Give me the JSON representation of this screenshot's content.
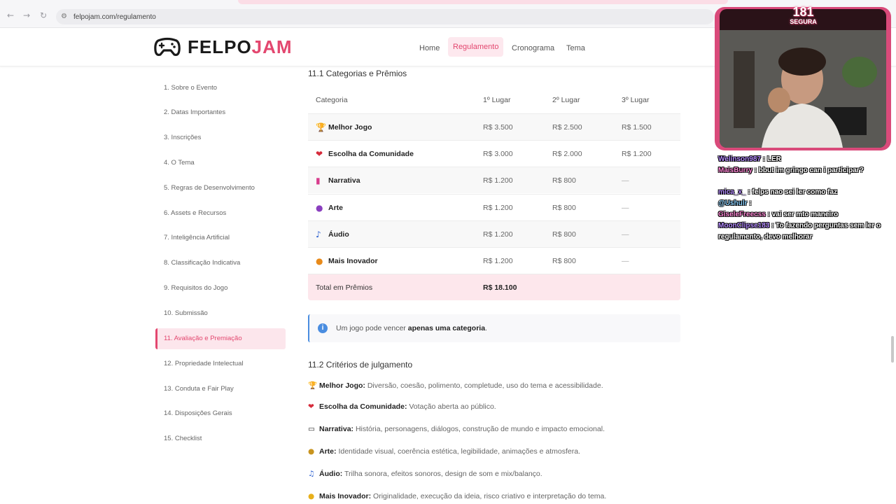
{
  "browser": {
    "url": "felpojam.com/regulamento",
    "back_icon": "back-arrow-icon",
    "forward_icon": "forward-arrow-icon",
    "reload_icon": "reload-icon"
  },
  "header": {
    "logo_part1": "FELPO",
    "logo_part2": "JAM",
    "nav": [
      "Home",
      "Regulamento",
      "Cronograma",
      "Tema"
    ],
    "active_nav": "Regulamento",
    "accent_color": "#e3476f"
  },
  "sidebar": {
    "items": [
      "1. Sobre o Evento",
      "2. Datas Importantes",
      "3. Inscrições",
      "4. O Tema",
      "5. Regras de Desenvolvimento",
      "6. Assets e Recursos",
      "7. Inteligência Artificial",
      "8. Classificação Indicativa",
      "9. Requisitos do Jogo",
      "10. Submissão",
      "11. Avaliação e Premiação",
      "12. Propriedade Intelectual",
      "13. Conduta e Fair Play",
      "14. Disposições Gerais",
      "15. Checklist"
    ],
    "active_index": 10
  },
  "main": {
    "section1_title": "11.1 Categorias e Prêmios",
    "table": {
      "headers": [
        "Categoria",
        "1º Lugar",
        "2º Lugar",
        "3º Lugar"
      ],
      "rows": [
        {
          "icon": "trophy-icon",
          "name": "Melhor Jogo",
          "p1": "R$ 3.500",
          "p2": "R$ 2.500",
          "p3": "R$ 1.500"
        },
        {
          "icon": "heart-icon",
          "name": "Escolha da Comunidade",
          "p1": "R$ 3.000",
          "p2": "R$ 2.000",
          "p3": "R$ 1.200"
        },
        {
          "icon": "book-icon",
          "name": "Narrativa",
          "p1": "R$ 1.200",
          "p2": "R$ 800",
          "p3": "—"
        },
        {
          "icon": "palette-icon",
          "name": "Arte",
          "p1": "R$ 1.200",
          "p2": "R$ 800",
          "p3": "—"
        },
        {
          "icon": "music-note-icon",
          "name": "Áudio",
          "p1": "R$ 1.200",
          "p2": "R$ 800",
          "p3": "—"
        },
        {
          "icon": "lightbulb-icon",
          "name": "Mais Inovador",
          "p1": "R$ 1.200",
          "p2": "R$ 800",
          "p3": "—"
        }
      ],
      "total_label": "Total em Prêmios",
      "total_value": "R$ 18.100"
    },
    "info": {
      "text_before": "Um jogo pode vencer ",
      "text_bold": "apenas uma categoria",
      "text_after": "."
    },
    "section2_title": "11.2 Critérios de julgamento",
    "criteria": [
      {
        "icon": "trophy-icon",
        "label": "Melhor Jogo:",
        "text": "Diversão, coesão, polimento, completude, uso do tema e acessibilidade."
      },
      {
        "icon": "heart-icon",
        "label": "Escolha da Comunidade:",
        "text": "Votação aberta ao público."
      },
      {
        "icon": "book-icon",
        "label": "Narrativa:",
        "text": "História, personagens, diálogos, construção de mundo e impacto emocional."
      },
      {
        "icon": "palette-icon",
        "label": "Arte:",
        "text": "Identidade visual, coerência estética, legibilidade, animações e atmosfera."
      },
      {
        "icon": "music-note-icon",
        "label": "Áudio:",
        "text": "Trilha sonora, efeitos sonoros, design de som e mix/balanço."
      },
      {
        "icon": "lightbulb-icon",
        "label": "Mais Inovador:",
        "text": "Originalidade, execução da ideia, risco criativo e interpretação do tema."
      }
    ]
  },
  "stream": {
    "counter_number": "181",
    "counter_label": "SEGURA",
    "chat": [
      {
        "user": "Welinson987",
        "msg": ": LER"
      },
      {
        "user": "MaisBurry",
        "msg": ": bbut im gringo can i participar?"
      },
      {
        "user": "mica_x_",
        "msg": ": felps nao sei ler como faz"
      },
      {
        "user": "@Ushulr",
        "msg": ":"
      },
      {
        "user": "GiseleFreecss",
        "msg": ": vai ser mto maneiro"
      },
      {
        "user": "MoonClipse183",
        "msg": ": To fazendo perguntas sem ler o"
      },
      {
        "user": "",
        "msg": "regulamento, devo melhorar"
      }
    ]
  }
}
